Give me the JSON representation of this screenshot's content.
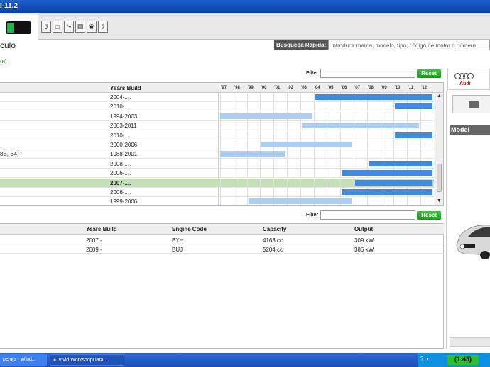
{
  "window": {
    "title": "I-11.2"
  },
  "toolbar": {
    "tools": [
      "J",
      "□",
      "↘",
      "▤",
      "◉",
      "?"
    ]
  },
  "page": {
    "title": "culo",
    "green_mark": "(ʀ)"
  },
  "quick_search": {
    "label": "Búsqueda Rápida:",
    "placeholder": "Introducir marca, modelo, tipo, código de motor o número"
  },
  "filter_top": {
    "label": "Filter",
    "reset": "Reset"
  },
  "filter_bottom": {
    "label": "Filter",
    "reset": "Reset"
  },
  "models_table": {
    "header": {
      "years_build": "Years Build"
    },
    "year_ticks": [
      "'97",
      "'98",
      "'99",
      "'00",
      "'01",
      "'02",
      "'03",
      "'04",
      "'05",
      "'06",
      "'07",
      "'08",
      "'09",
      "'10",
      "'11",
      "'12"
    ],
    "rows": [
      {
        "name": "",
        "years": "2004-....",
        "start": 2004,
        "end": 2012,
        "shade": "dark"
      },
      {
        "name": "",
        "years": "2010-....",
        "start": 2010,
        "end": 2012,
        "shade": "dark"
      },
      {
        "name": "",
        "years": "1994-2003",
        "start": 1997,
        "end": 2003,
        "shade": "light"
      },
      {
        "name": "",
        "years": "2003-2011",
        "start": 2003,
        "end": 2011,
        "shade": "light"
      },
      {
        "name": "",
        "years": "2010-....",
        "start": 2010,
        "end": 2012,
        "shade": "dark"
      },
      {
        "name": "",
        "years": "2000-2006",
        "start": 2000,
        "end": 2006,
        "shade": "light"
      },
      {
        "name": "8B, B4)",
        "years": "1988-2001",
        "start": 1997,
        "end": 2001,
        "shade": "light"
      },
      {
        "name": "",
        "years": "2008-....",
        "start": 2008,
        "end": 2012,
        "shade": "dark"
      },
      {
        "name": "",
        "years": "2006-....",
        "start": 2006,
        "end": 2012,
        "shade": "dark"
      },
      {
        "name": "",
        "years": "2007-....",
        "start": 2007,
        "end": 2012,
        "shade": "dark",
        "selected": true
      },
      {
        "name": "",
        "years": "2006-....",
        "start": 2006,
        "end": 2012,
        "shade": "dark"
      },
      {
        "name": "",
        "years": "1999-2006",
        "start": 1999,
        "end": 2006,
        "shade": "light"
      }
    ]
  },
  "engines_table": {
    "headers": {
      "years_build": "Years Build",
      "engine_code": "Engine Code",
      "capacity": "Capacity",
      "output": "Output"
    },
    "rows": [
      {
        "years": "2007 -",
        "engine": "BYH",
        "capacity": "4163 cc",
        "output": "309 kW"
      },
      {
        "years": "2009 -",
        "engine": "BUJ",
        "capacity": "5204 cc",
        "output": "386 kW"
      }
    ]
  },
  "brand": {
    "name": "Audi"
  },
  "right_panel": {
    "model_header": "Model"
  },
  "taskbar": {
    "task1": "релиз - Wind...",
    "task2": "Vivid WorkshopData ...",
    "tray_help": "?",
    "clock": "(1:45)"
  },
  "colors": {
    "bar_dark": "#3f8ae3",
    "bar_light": "#aacdf1",
    "selected_row": "#c2dfb6",
    "reset_green": "#2aa82a"
  }
}
